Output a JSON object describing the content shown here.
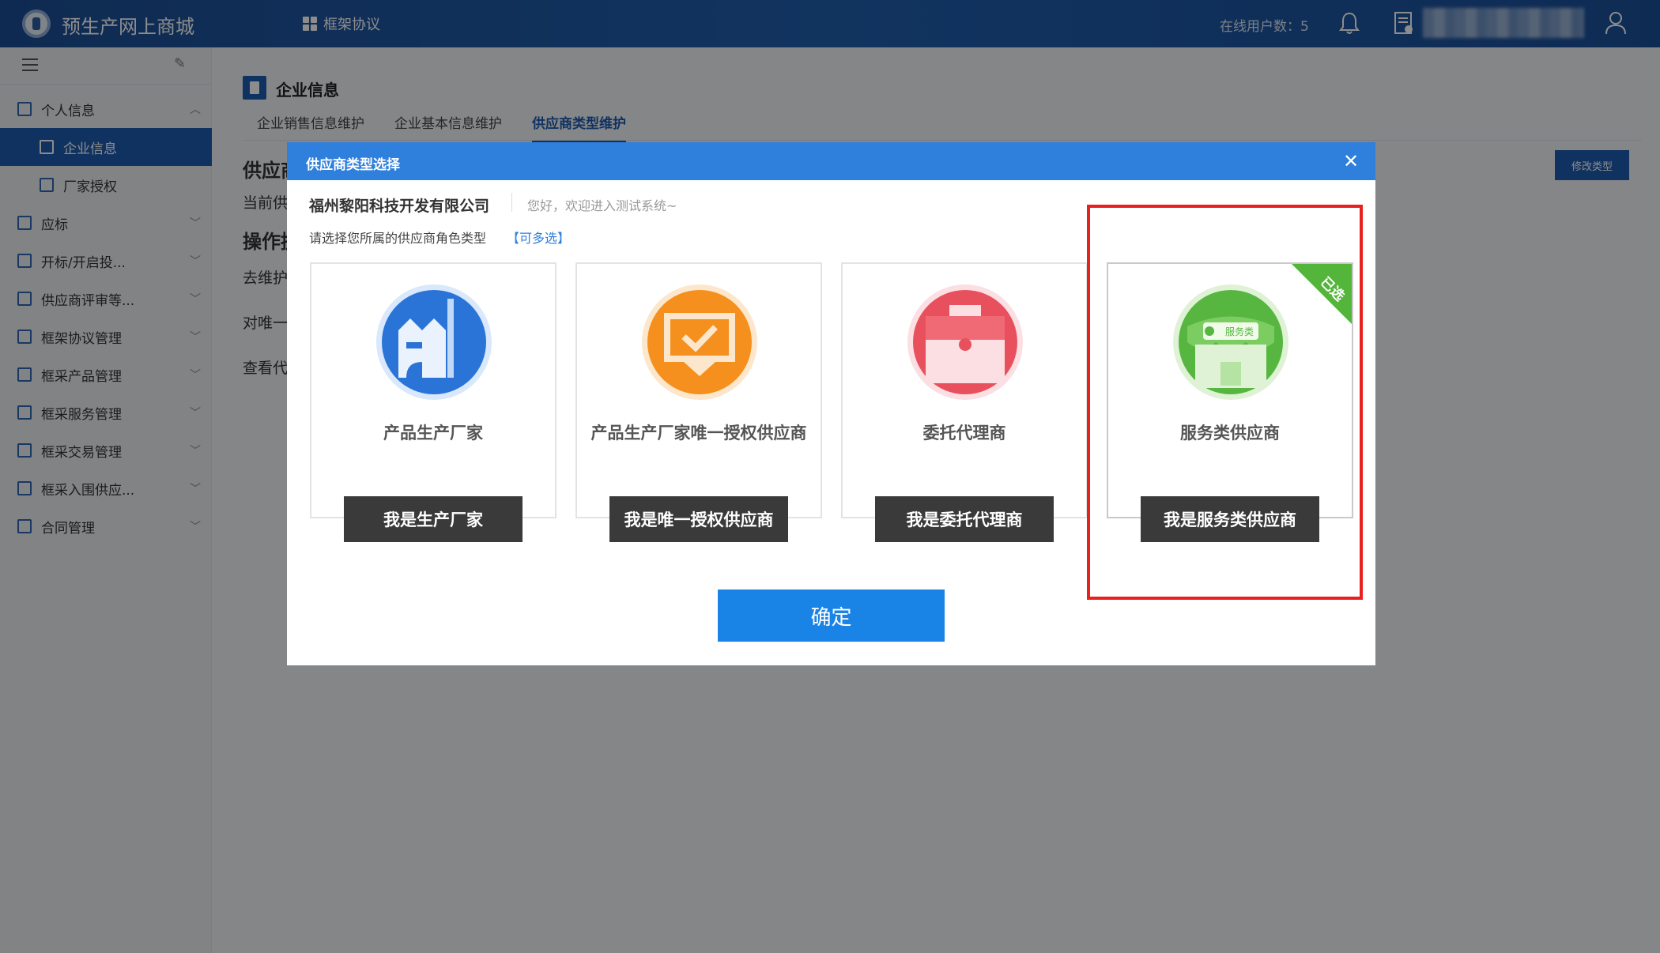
{
  "topbar": {
    "app_title": "预生产网上商城",
    "nav_label": "框架协议",
    "online_users": "在线用户数：5"
  },
  "sidebar": {
    "items": [
      {
        "label": "个人信息",
        "expanded": true
      },
      {
        "label": "企业信息",
        "sub": true,
        "active": true
      },
      {
        "label": "厂家授权",
        "sub": true
      },
      {
        "label": "应标"
      },
      {
        "label": "开标/开启投..."
      },
      {
        "label": "供应商评审等..."
      },
      {
        "label": "框架协议管理"
      },
      {
        "label": "框采产品管理"
      },
      {
        "label": "框采服务管理"
      },
      {
        "label": "框采交易管理"
      },
      {
        "label": "框采入围供应..."
      },
      {
        "label": "合同管理"
      }
    ]
  },
  "main": {
    "page_title": "企业信息",
    "tabs": [
      "企业销售信息维护",
      "企业基本信息维护",
      "供应商类型维护"
    ],
    "active_tab": 2,
    "bg_lines": [
      "供应商",
      "当前供",
      "操作提",
      "去维护",
      "对唯一",
      "查看代"
    ],
    "edit_type_button": "修改类型"
  },
  "modal": {
    "title": "供应商类型选择",
    "company": "福州黎阳科技开发有限公司",
    "welcome": "您好，欢迎进入测试系统~",
    "prompt": "请选择您所属的供应商角色类型",
    "multi_hint": "【可多选】",
    "cards": [
      {
        "label": "产品生产厂家",
        "button": "我是生产厂家",
        "icon": "factory-icon",
        "color": "#2a74d8",
        "selected": false
      },
      {
        "label": "产品生产厂家唯一授权供应商",
        "button": "我是唯一授权供应商",
        "icon": "authorized-check-icon",
        "color": "#f5901e",
        "selected": false
      },
      {
        "label": "委托代理商",
        "button": "我是委托代理商",
        "icon": "briefcase-icon",
        "color": "#e9505e",
        "selected": false
      },
      {
        "label": "服务类供应商",
        "button": "我是服务类供应商",
        "icon": "service-store-icon",
        "color": "#56b640",
        "selected": true,
        "badge": "已选",
        "store_sign": "服务类"
      }
    ],
    "confirm": "确定"
  },
  "colors": {
    "topbar": "#1f5fae",
    "accent": "#1e5bb0",
    "modal_header": "#2f7fdc",
    "highlight": "#e8201f",
    "confirm": "#1a84e6"
  }
}
